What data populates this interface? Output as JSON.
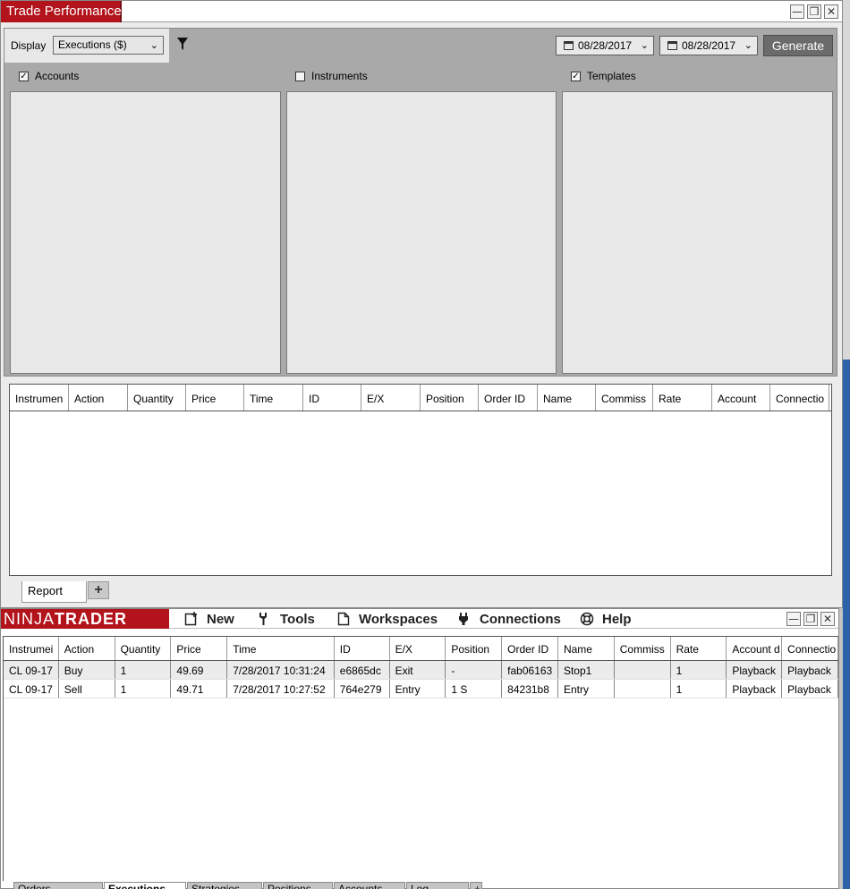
{
  "trade_performance": {
    "title": "Trade Performance",
    "window_buttons": [
      "—",
      "❐",
      "✕"
    ],
    "display_label": "Display",
    "display_value": "Executions ($)",
    "date_from": "08/28/2017",
    "date_to": "08/28/2017",
    "generate_label": "Generate",
    "filters": [
      {
        "label": "Accounts",
        "checked": true,
        "check": "✓"
      },
      {
        "label": "Instruments",
        "checked": false,
        "check": ""
      },
      {
        "label": "Templates",
        "checked": true,
        "check": "✓"
      }
    ],
    "report_columns": [
      "Instrumen",
      "Action",
      "Quantity",
      "Price",
      "Time",
      "ID",
      "E/X",
      "Position",
      "Order ID",
      "Name",
      "Commiss",
      "Rate",
      "Account",
      "Connectio"
    ],
    "tabs": {
      "report": "Report",
      "add": "+"
    }
  },
  "control_center": {
    "logo_thin": "NINJA",
    "logo_bold": "TRADER",
    "menu": {
      "new": "New",
      "tools": "Tools",
      "workspaces": "Workspaces",
      "connections": "Connections",
      "help": "Help"
    },
    "window_buttons": [
      "—",
      "❐",
      "✕"
    ],
    "exec_columns": [
      "Instrumei",
      "Action",
      "Quantity",
      "Price",
      "Time",
      "ID",
      "E/X",
      "Position",
      "Order ID",
      "Name",
      "Commiss",
      "Rate",
      "Account d",
      "Connectio"
    ],
    "rows": [
      [
        "CL 09-17",
        "Buy",
        "1",
        "49.69",
        "7/28/2017 10:31:24",
        "e6865dc",
        "Exit",
        "-",
        "fab06163",
        "Stop1",
        "",
        "1",
        "Playback",
        "Playback"
      ],
      [
        "CL 09-17",
        "Sell",
        "1",
        "49.71",
        "7/28/2017 10:27:52",
        "764e279",
        "Entry",
        "1 S",
        "84231b8",
        "Entry",
        "",
        "1",
        "Playback",
        "Playback"
      ]
    ],
    "bottom_tabs": [
      "Orders",
      "Executions",
      "Strategies",
      "Positions",
      "Accounts",
      "Log",
      "+"
    ]
  },
  "colors": {
    "brand_red": "#b3131b",
    "generate_gray": "#6b6b6b",
    "scroll_blue": "#2d62a8"
  }
}
